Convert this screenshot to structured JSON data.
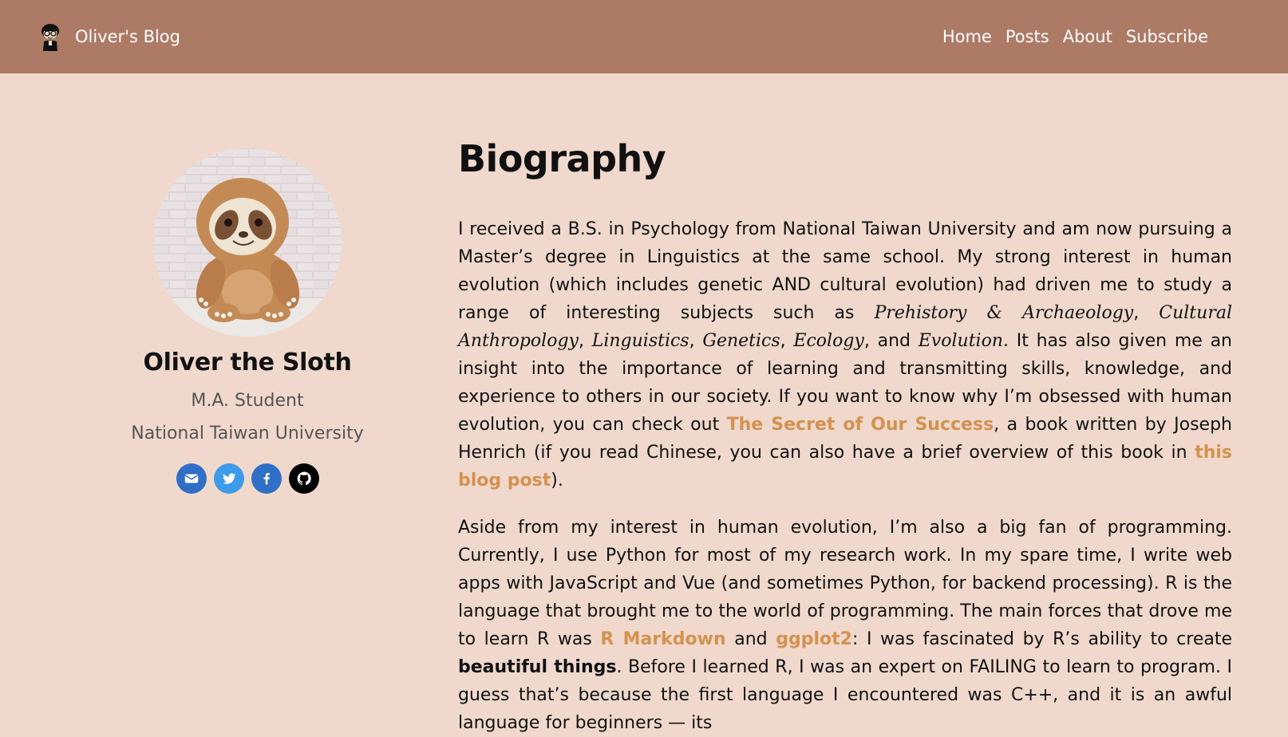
{
  "navbar": {
    "brand": "Oliver's Blog",
    "links": [
      "Home",
      "Posts",
      "About",
      "Subscribe"
    ]
  },
  "profile": {
    "name": "Oliver the Sloth",
    "role": "M.A. Student",
    "affiliation": "National Taiwan University",
    "social_icons": [
      "envelope-icon",
      "twitter-icon",
      "facebook-icon",
      "github-icon"
    ]
  },
  "bio": {
    "title": "Biography",
    "p1": {
      "t1": "I received a B.S. in Psychology from National Taiwan University and am now pursuing a Master’s degree in Linguistics at the same school. My strong interest in human evolution (which includes genetic AND cultural evolution) had driven me to study a range of interesting subjects such as ",
      "e1": "Prehistory & Archaeology",
      "t2": ", ",
      "e2": "Cultural Anthropology",
      "t3": ", ",
      "e3": "Linguistics",
      "t4": ", ",
      "e4": "Genetics",
      "t5": ", ",
      "e5": "Ecology",
      "t6": ", and ",
      "e6": "Evolution",
      "t7": ". It has also given me an insight into the importance of learning and transmitting skills, knowledge, and experience to others in our society. If you want to know why I’m obsessed with human evolution, you can check out ",
      "link1": "The Secret of Our Success",
      "t8": ", a book written by Joseph Henrich (if you read Chinese, you can also have a brief overview of this book in ",
      "link2": "this blog post",
      "t9": ")."
    },
    "p2": {
      "t1": "Aside from my interest in human evolution, I’m also a big fan of programming. Currently, I use Python for most of my research work. In my spare time, I write web apps with JavaScript and Vue (and sometimes Python, for backend processing). R is the language that brought me to the world of programming. The main forces that drove me to learn R was ",
      "link1": "R Markdown",
      "t2": " and ",
      "link2": "ggplot2",
      "t3": ": I was fascinated by R’s ability to create ",
      "strong": "beautiful things",
      "t4": ". Before I learned R, I was an expert on FAILING to learn to program. I guess that’s because the first language I encountered was C++, and it is an awful language for beginners — its"
    }
  },
  "colors": {
    "navbar": "#ad7a66",
    "background": "#f0d9cc",
    "link": "#d4914f",
    "email": "#2f6fc8",
    "twitter": "#3d9be9",
    "facebook": "#2f6fc8",
    "github": "#000000"
  }
}
